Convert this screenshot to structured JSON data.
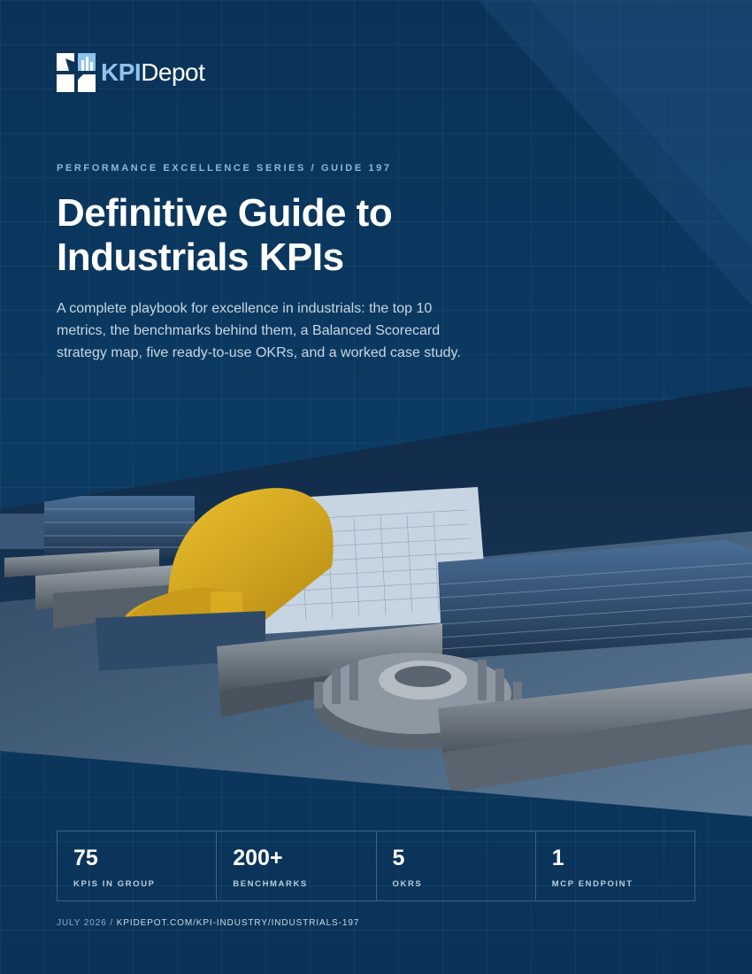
{
  "brand": {
    "name_part1": "KPI",
    "name_part2": "Depot",
    "logo_icon": "kpidepot-logo-icon",
    "accent_color": "#8fc3ea"
  },
  "cover": {
    "eyebrow": "PERFORMANCE EXCELLENCE SERIES / GUIDE 197",
    "title_line1": "Definitive Guide to",
    "title_line2": "Industrials KPIs",
    "subtitle": "A complete playbook for excellence in industrials: the top 10 metrics, the benchmarks behind them, a Balanced Scorecard strategy map, five ready-to-use OKRs, and a worked case study.",
    "background_color": "#0b3458"
  },
  "stats": [
    {
      "value": "75",
      "label": "KPIS IN GROUP"
    },
    {
      "value": "200+",
      "label": "BENCHMARKS"
    },
    {
      "value": "5",
      "label": "OKRS"
    },
    {
      "value": "1",
      "label": "MCP ENDPOINT"
    }
  ],
  "footer": {
    "date": "JULY 2026",
    "separator": " / ",
    "url": "KPIDEPOT.COM/KPI-INDUSTRY/INDUSTRIALS-197"
  }
}
